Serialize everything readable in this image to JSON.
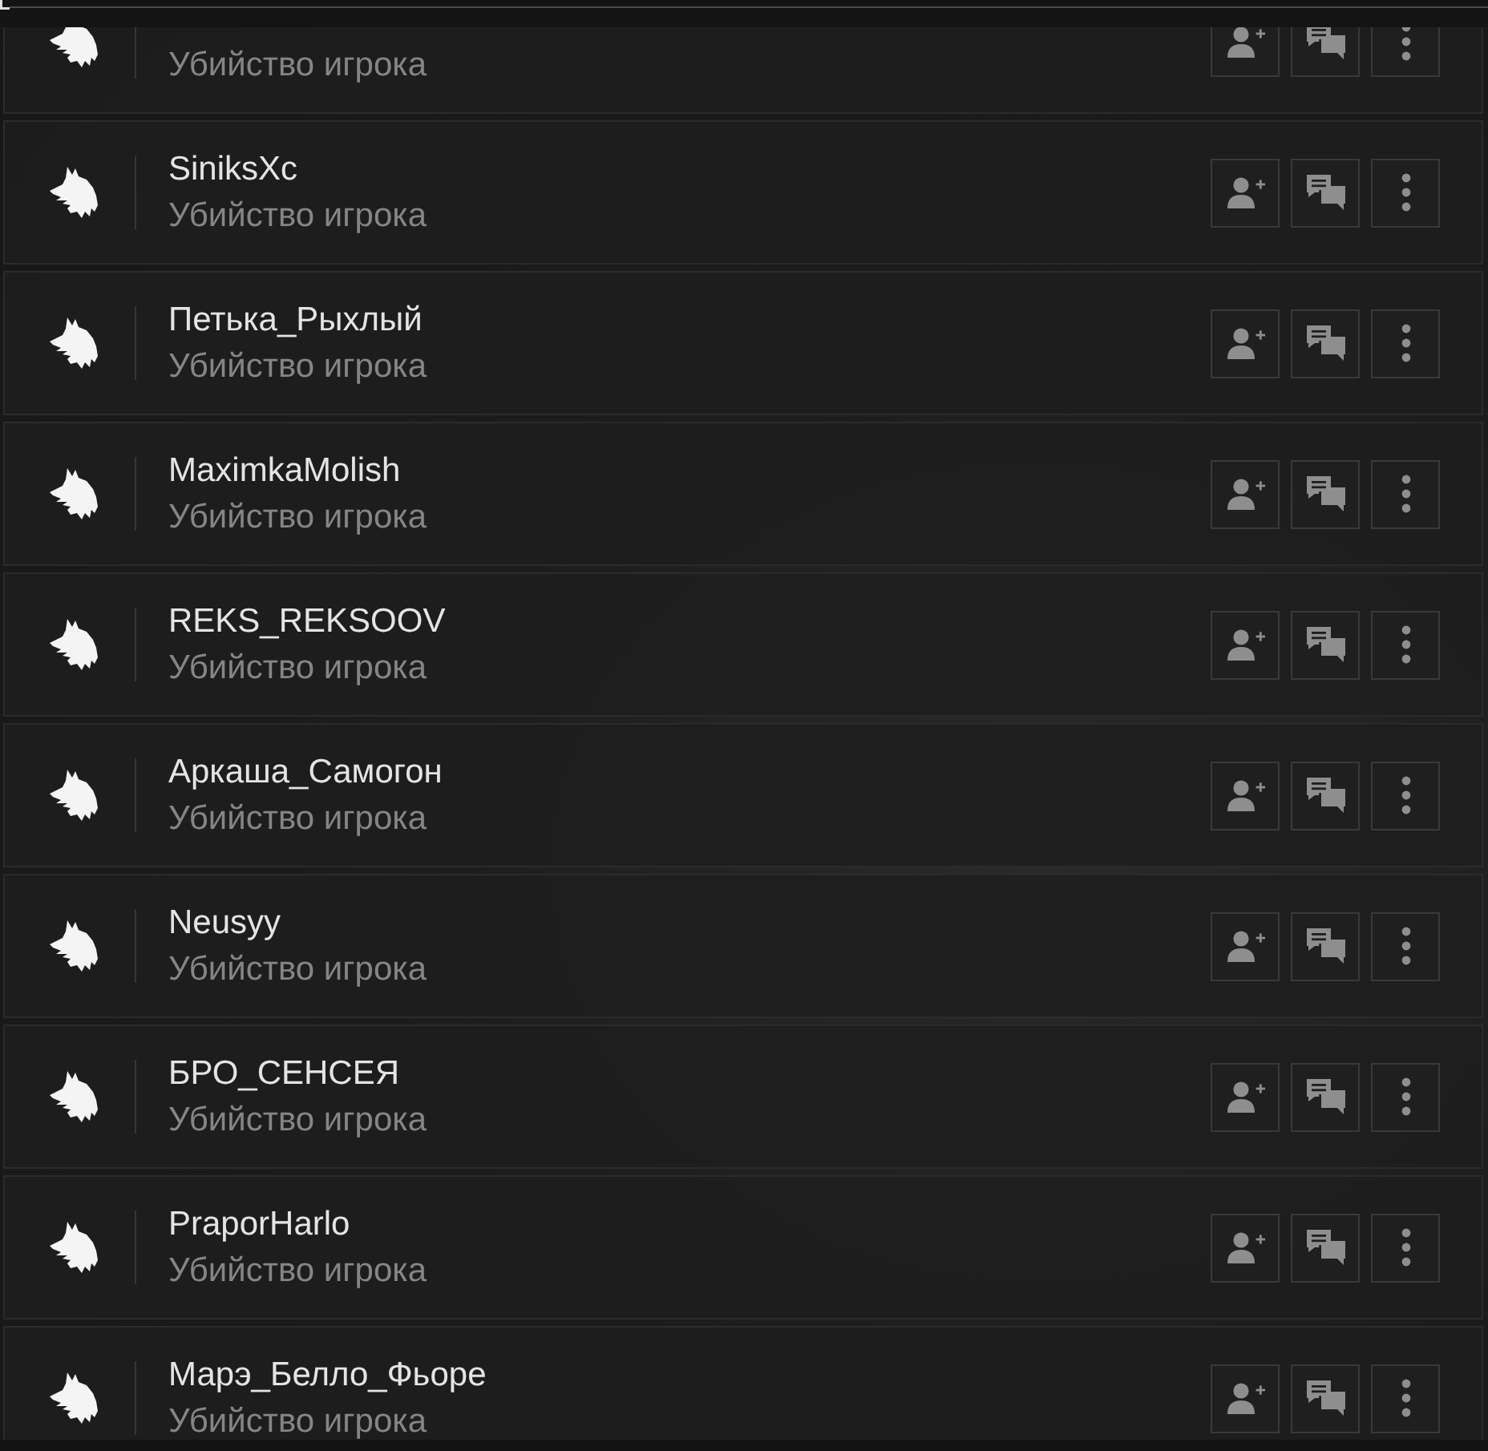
{
  "rows": [
    {
      "subtitle": "Убийство игрока"
    },
    {
      "name": "SiniksXc",
      "subtitle": "Убийство игрока"
    },
    {
      "name": "Петька_Рыхлый",
      "subtitle": "Убийство игрока"
    },
    {
      "name": "MaximkaMolish",
      "subtitle": "Убийство игрока"
    },
    {
      "name": "REKS_REKSOOV",
      "subtitle": "Убийство игрока"
    },
    {
      "name": "Аркаша_Самогон",
      "subtitle": "Убийство игрока"
    },
    {
      "name": "Neusyy",
      "subtitle": "Убийство игрока"
    },
    {
      "name": "БРО_СЕНСЕЯ",
      "subtitle": "Убийство игрока"
    },
    {
      "name": "PraporHarlo",
      "subtitle": "Убийство игрока"
    },
    {
      "name": "Марэ_Белло_Фьоре",
      "subtitle": "Убийство игрока"
    }
  ]
}
